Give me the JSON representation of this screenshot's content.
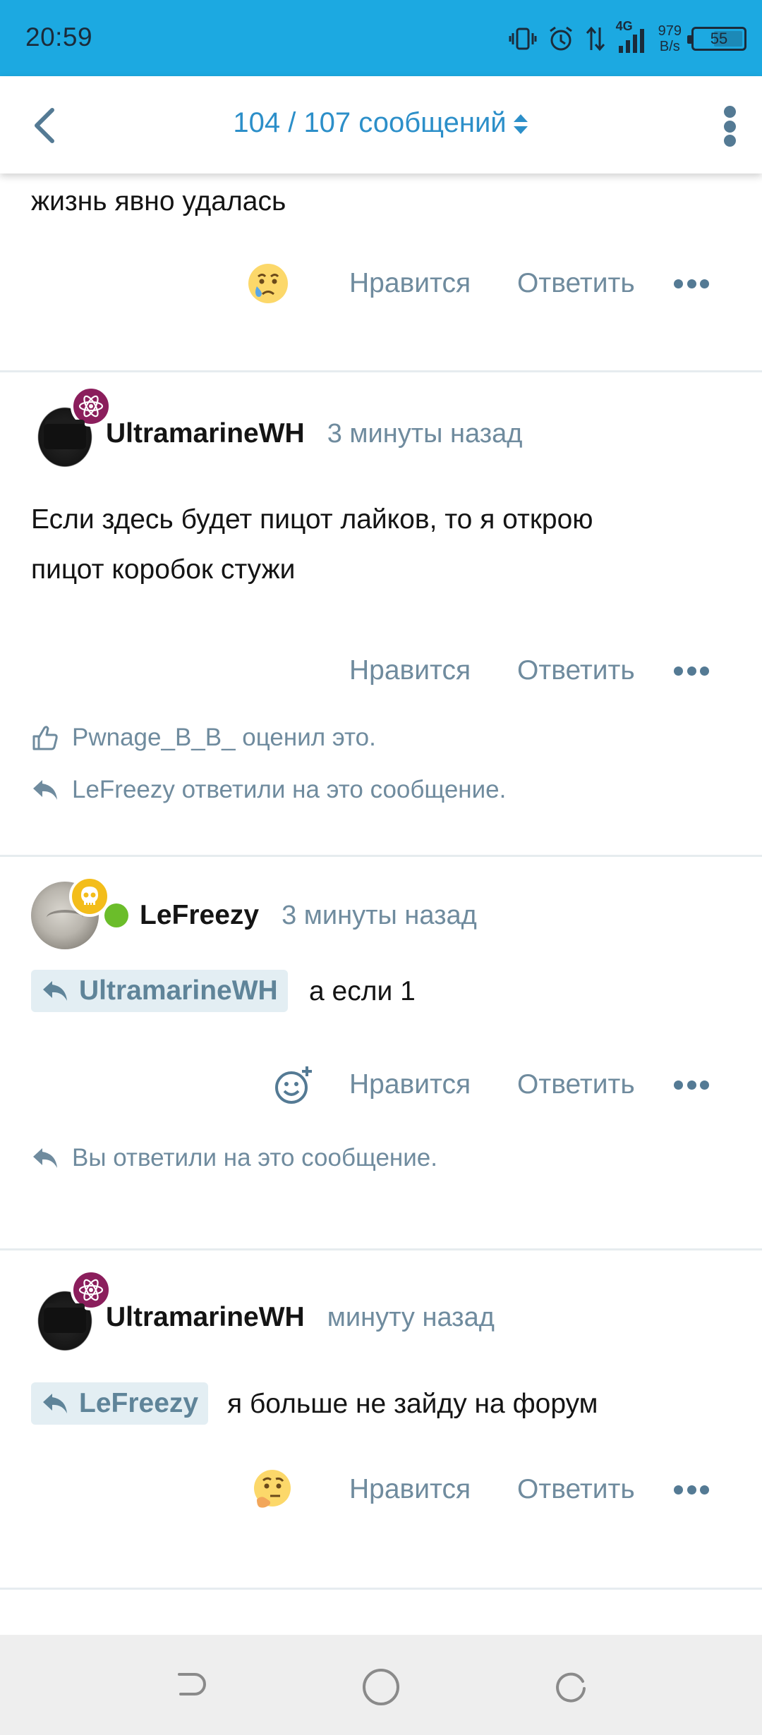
{
  "status_bar": {
    "time": "20:59",
    "network_label": "4G",
    "speed_value": "979",
    "speed_unit": "B/s",
    "battery": "55",
    "color": "#1ca9e1"
  },
  "header": {
    "title": "104 / 107 сообщений",
    "accent": "#2c8fc9"
  },
  "actions": {
    "like_label": "Нравится",
    "reply_label": "Ответить"
  },
  "posts": [
    {
      "text": "жизнь явно удалась",
      "reaction_icon": "crying-emoji-icon"
    },
    {
      "author": "UltramarineWH",
      "time": "3 минуты назад",
      "badge_icon": "atom-icon",
      "text_line1": "Если здесь будет пицот лайков, то я открою",
      "text_line2": "пицот коробок стужи",
      "liked_by": "Pwnage_B_B_ оценил это.",
      "replied_by": "LeFreezy ответили на это сообщение."
    },
    {
      "author": "LeFreezy",
      "time": "3 минуты назад",
      "badge_icon": "skull-icon",
      "online": true,
      "quote_author": "UltramarineWH",
      "text": "а если 1",
      "reaction_icon": "add-reaction-icon",
      "replied_by": "Вы ответили на это сообщение."
    },
    {
      "author": "UltramarineWH",
      "time": "минуту назад",
      "badge_icon": "atom-icon",
      "quote_author": "LeFreezy",
      "text": "я больше не зайду на форум",
      "reaction_icon": "thinking-emoji-icon"
    }
  ]
}
